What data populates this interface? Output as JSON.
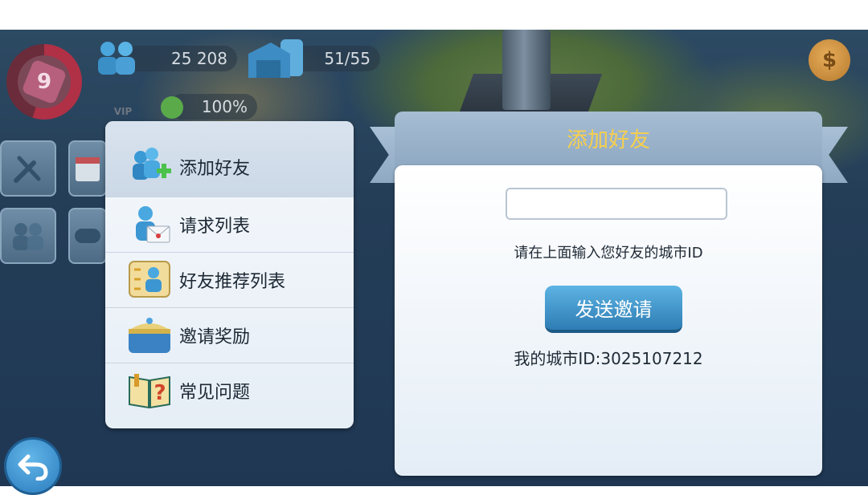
{
  "hud": {
    "level": "9",
    "population": "25 208",
    "storage": "51/55",
    "happiness": "100%",
    "vip": "VIP"
  },
  "menu": {
    "items": [
      {
        "label": "添加好友",
        "icon": "add-friend-icon",
        "active": true
      },
      {
        "label": "请求列表",
        "icon": "request-mail-icon",
        "active": false
      },
      {
        "label": "好友推荐列表",
        "icon": "recommend-list-icon",
        "active": false
      },
      {
        "label": "邀请奖励",
        "icon": "reward-chest-icon",
        "active": false
      },
      {
        "label": "常见问题",
        "icon": "faq-book-icon",
        "active": false
      }
    ]
  },
  "add_friend": {
    "title": "添加好友",
    "input_value": "",
    "hint": "请在上面输入您好友的城市ID",
    "send_button": "发送邀请",
    "my_id_text": "我的城市ID:3025107212"
  },
  "colors": {
    "title": "#f7cf4d",
    "button": "#2e7db4",
    "panel": "#e4edf6"
  }
}
